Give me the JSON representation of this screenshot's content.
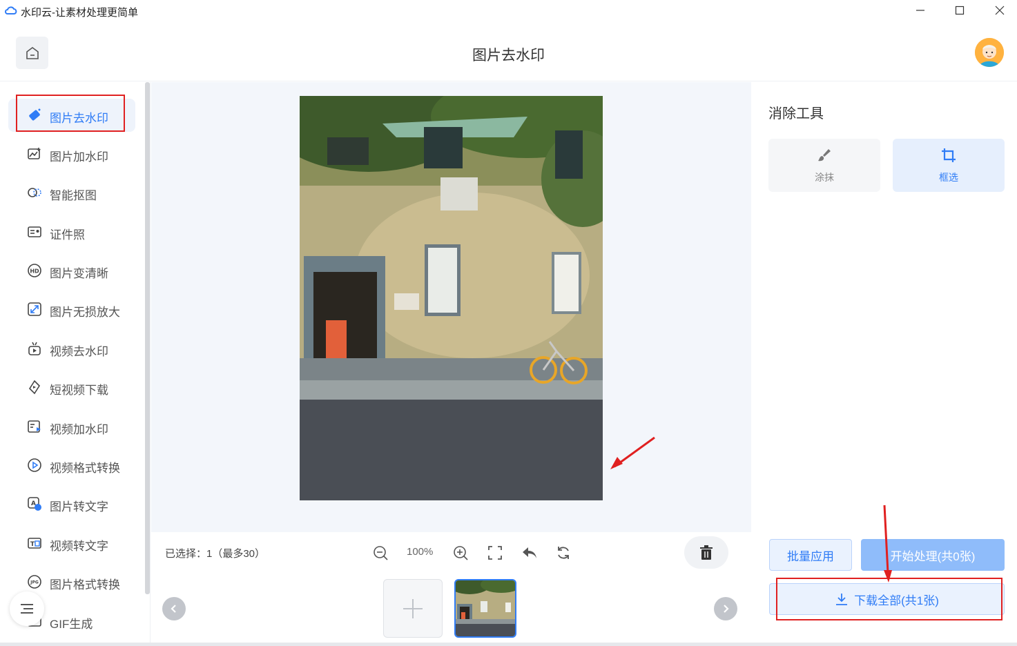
{
  "window": {
    "title": "水印云-让素材处理更简单"
  },
  "header": {
    "title": "图片去水印"
  },
  "sidebar": {
    "items": [
      {
        "label": "图片去水印",
        "icon": "eraser-icon",
        "active": true
      },
      {
        "label": "图片加水印",
        "icon": "image-add-icon"
      },
      {
        "label": "智能抠图",
        "icon": "cutout-icon"
      },
      {
        "label": "证件照",
        "icon": "id-card-icon"
      },
      {
        "label": "图片变清晰",
        "icon": "hd-icon"
      },
      {
        "label": "图片无损放大",
        "icon": "expand-icon"
      },
      {
        "label": "视频去水印",
        "icon": "video-eraser-icon"
      },
      {
        "label": "短视频下载",
        "icon": "video-download-icon"
      },
      {
        "label": "视频加水印",
        "icon": "video-add-icon"
      },
      {
        "label": "视频格式转换",
        "icon": "play-circle-icon"
      },
      {
        "label": "图片转文字",
        "icon": "image-text-icon"
      },
      {
        "label": "视频转文字",
        "icon": "video-text-icon"
      },
      {
        "label": "图片格式转换",
        "icon": "jpg-icon"
      },
      {
        "label": "GIF生成",
        "icon": "gif-icon"
      }
    ]
  },
  "toolbar": {
    "selected": "已选择：1（最多30）",
    "zoom": "100%"
  },
  "tools": {
    "title": "消除工具",
    "items": [
      {
        "label": "涂抹",
        "icon": "brush-icon"
      },
      {
        "label": "框选",
        "icon": "crop-icon",
        "active": true
      }
    ]
  },
  "actions": {
    "batch": "批量应用",
    "start": "开始处理(共0张)",
    "download": "下载全部(共1张)"
  },
  "colors": {
    "accent": "#2f7cf6",
    "annotation": "#e02020"
  }
}
